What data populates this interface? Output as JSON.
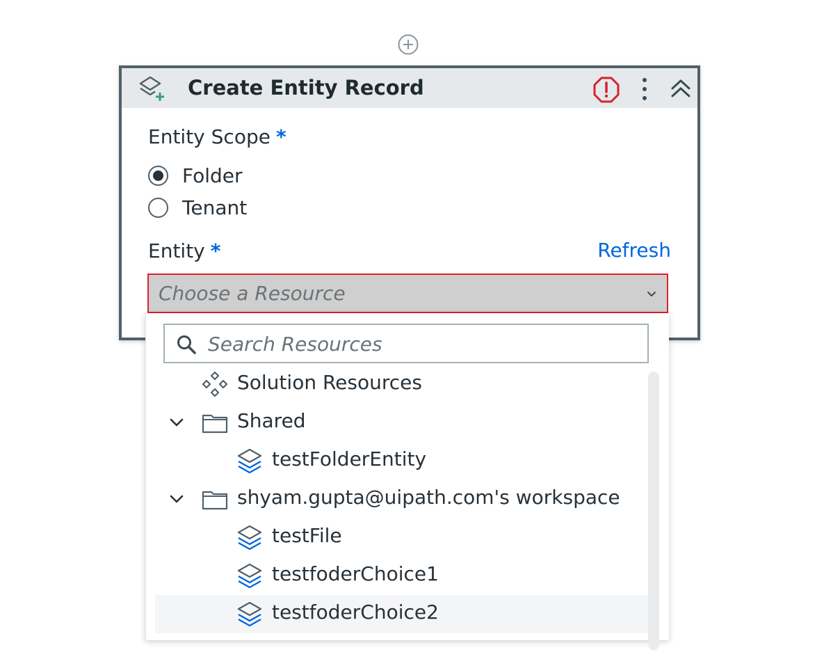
{
  "card": {
    "title": "Create Entity Record",
    "entity_scope_label": "Entity Scope",
    "required_mark": "*",
    "scope_options": [
      {
        "label": "Folder",
        "checked": true
      },
      {
        "label": "Tenant",
        "checked": false
      }
    ],
    "entity_label": "Entity",
    "refresh_label": "Refresh",
    "dropdown_placeholder": "Choose a Resource"
  },
  "popup": {
    "search_placeholder": "Search Resources",
    "items": [
      {
        "label": "Solution Resources",
        "icon": "solution-resources-icon",
        "level": 0,
        "expandable": false
      },
      {
        "label": "Shared",
        "icon": "folder-icon",
        "level": 0,
        "expandable": true,
        "expanded": true
      },
      {
        "label": "testFolderEntity",
        "icon": "entity-icon",
        "level": 1
      },
      {
        "label": "shyam.gupta@uipath.com's workspace",
        "icon": "folder-icon",
        "level": 0,
        "expandable": true,
        "expanded": true
      },
      {
        "label": "testFile",
        "icon": "entity-icon",
        "level": 1
      },
      {
        "label": "testfoderChoice1",
        "icon": "entity-icon",
        "level": 1
      },
      {
        "label": "testfoderChoice2",
        "icon": "entity-icon",
        "level": 1,
        "hovered": true
      }
    ]
  },
  "colors": {
    "accent": "#0067df",
    "error": "#e0202b",
    "header_bg": "#e6e9eb",
    "card_border": "#526069",
    "add_icon_green": "#38a169"
  }
}
